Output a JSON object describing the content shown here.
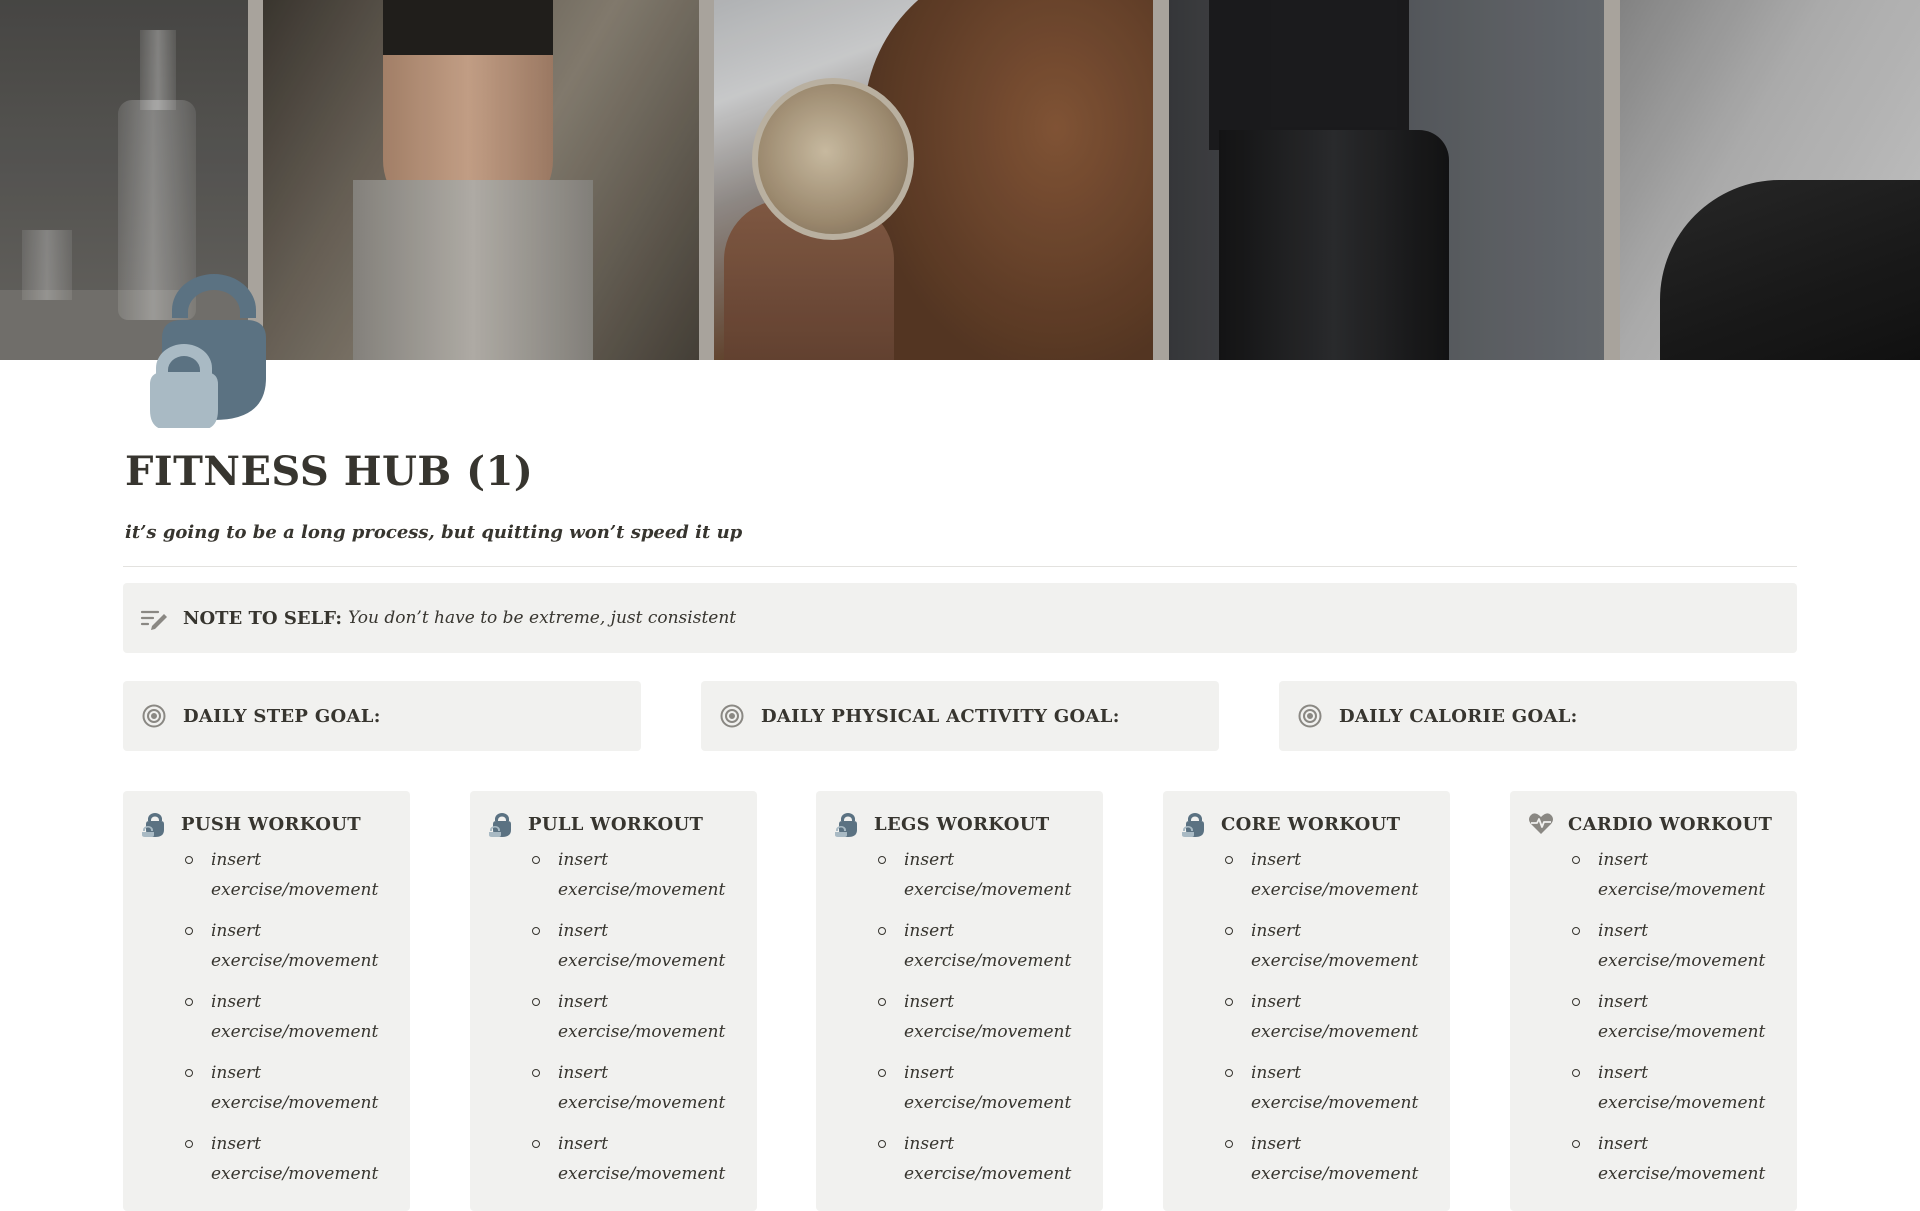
{
  "page": {
    "title": "FITNESS HUB (1)",
    "subtitle": "it’s going to be a long process, but quitting won’t speed it up",
    "icon": "kettlebell-icon"
  },
  "note": {
    "icon": "pencil-lines-icon",
    "label": "NOTE TO SELF:",
    "text": "You don’t have to be extreme, just consistent"
  },
  "goals": [
    {
      "icon": "target-icon",
      "label": "DAILY STEP GOAL:"
    },
    {
      "icon": "target-icon",
      "label": "DAILY PHYSICAL ACTIVITY GOAL:"
    },
    {
      "icon": "target-icon",
      "label": "DAILY CALORIE GOAL:"
    }
  ],
  "workouts": [
    {
      "icon": "kettlebell-icon",
      "title": "PUSH WORKOUT",
      "items": [
        "insert exercise/movement",
        "insert exercise/movement",
        "insert exercise/movement",
        "insert exercise/movement",
        "insert exercise/movement"
      ]
    },
    {
      "icon": "kettlebell-icon",
      "title": "PULL WORKOUT",
      "items": [
        "insert exercise/movement",
        "insert exercise/movement",
        "insert exercise/movement",
        "insert exercise/movement",
        "insert exercise/movement"
      ]
    },
    {
      "icon": "kettlebell-icon",
      "title": "LEGS WORKOUT",
      "items": [
        "insert exercise/movement",
        "insert exercise/movement",
        "insert exercise/movement",
        "insert exercise/movement",
        "insert exercise/movement"
      ]
    },
    {
      "icon": "kettlebell-icon",
      "title": "CORE WORKOUT",
      "items": [
        "insert exercise/movement",
        "insert exercise/movement",
        "insert exercise/movement",
        "insert exercise/movement",
        "insert exercise/movement"
      ]
    },
    {
      "icon": "heart-pulse-icon",
      "title": "CARDIO WORKOUT",
      "items": [
        "insert exercise/movement",
        "insert exercise/movement",
        "insert exercise/movement",
        "insert exercise/movement",
        "insert exercise/movement"
      ]
    }
  ],
  "colors": {
    "text": "#37352f",
    "callout_bg": "#f1f1ef",
    "icon_dark": "#5b7282",
    "icon_light": "#a9bac4"
  }
}
